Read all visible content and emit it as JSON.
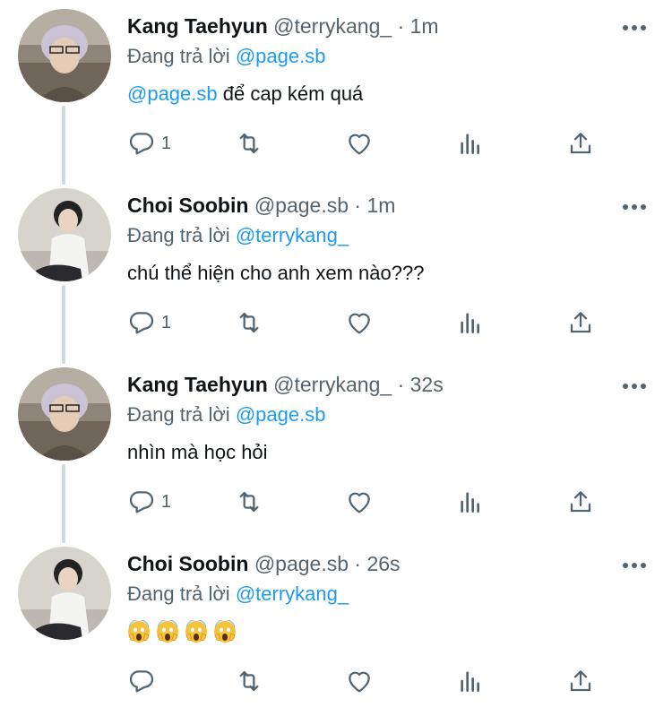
{
  "tweets": [
    {
      "name": "Kang Taehyun",
      "handle": "@terrykang_",
      "dot": "·",
      "time": "1m",
      "reply_prefix": "Đang trả lời",
      "reply_to": "@page.sb",
      "body_mention": "@page.sb",
      "body_text": " để cap kém quá",
      "reply_count": "1",
      "avatar": "avatar-kang-taehyun"
    },
    {
      "name": "Choi Soobin",
      "handle": "@page.sb",
      "dot": "·",
      "time": "1m",
      "reply_prefix": "Đang trả lời",
      "reply_to": "@terrykang_",
      "body_mention": "",
      "body_text": "chú thể hiện cho anh xem nào???",
      "reply_count": "1",
      "avatar": "avatar-choi-soobin"
    },
    {
      "name": "Kang Taehyun",
      "handle": "@terrykang_",
      "dot": "·",
      "time": "32s",
      "reply_prefix": "Đang trả lời",
      "reply_to": "@page.sb",
      "body_mention": "",
      "body_text": "nhìn mà học hỏi",
      "reply_count": "1",
      "avatar": "avatar-kang-taehyun"
    },
    {
      "name": "Choi Soobin",
      "handle": "@page.sb",
      "dot": "·",
      "time": "26s",
      "reply_prefix": "Đang trả lời",
      "reply_to": "@terrykang_",
      "body_mention": "",
      "body_text": "",
      "emoji": [
        "screaming-face-emoji",
        "screaming-face-emoji",
        "screaming-face-emoji",
        "screaming-face-emoji"
      ],
      "reply_count": "",
      "avatar": "avatar-choi-soobin"
    }
  ],
  "icons": {
    "more": "more-dots-icon",
    "reply": "reply-bubble-icon",
    "retweet": "retweet-icon",
    "like": "heart-icon",
    "stats": "analytics-bars-icon",
    "share": "share-upload-icon"
  },
  "colors": {
    "text": "#0f1419",
    "secondary": "#536471",
    "link": "#1d9bf0",
    "thread_line": "#cfd9de"
  }
}
